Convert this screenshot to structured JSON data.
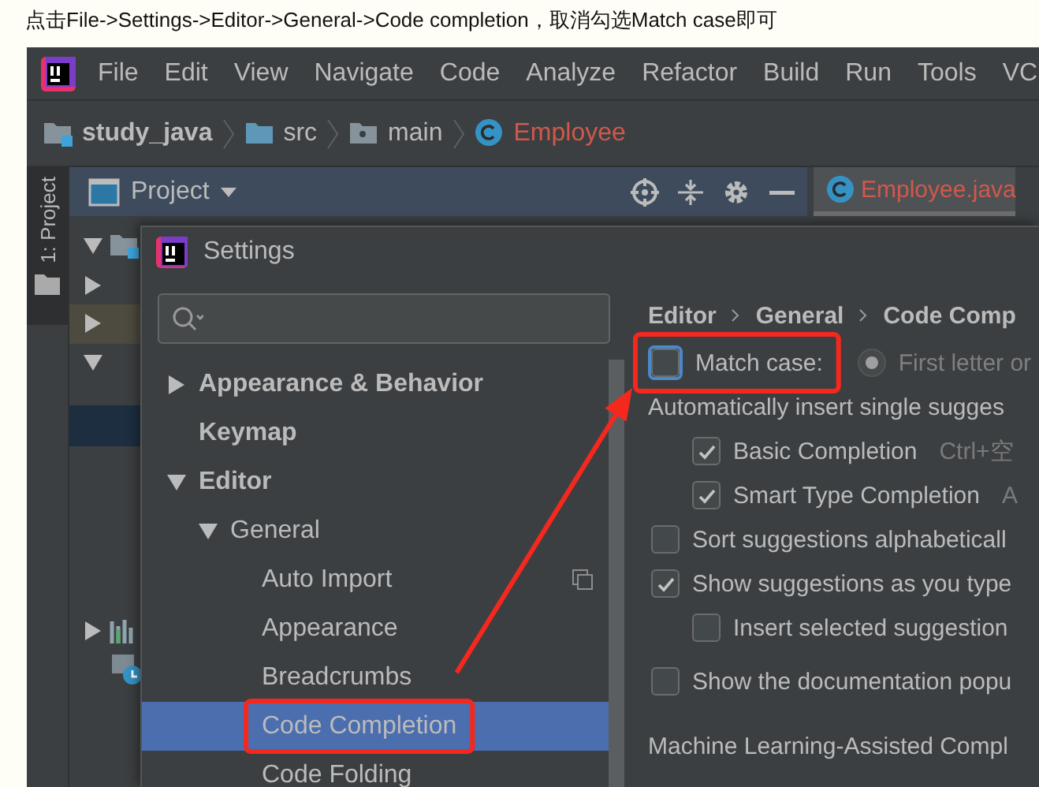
{
  "caption": "点击File->Settings->Editor->General->Code completion，取消勾选Match case即可",
  "menu": [
    "File",
    "Edit",
    "View",
    "Navigate",
    "Code",
    "Analyze",
    "Refactor",
    "Build",
    "Run",
    "Tools",
    "VC"
  ],
  "breadcrumbs": [
    {
      "label": "study_java",
      "kind": "project"
    },
    {
      "label": "src",
      "kind": "folder"
    },
    {
      "label": "main",
      "kind": "package"
    },
    {
      "label": "Employee",
      "kind": "class"
    }
  ],
  "side_tab": "1: Project",
  "project_panel": {
    "title": "Project"
  },
  "editor_tabs": [
    {
      "label": "Employee.java",
      "selected": true
    }
  ],
  "project_tree": [
    {
      "kind": "node",
      "expanded": true,
      "selected": false
    },
    {
      "kind": "node",
      "expanded": false,
      "selected": false
    },
    {
      "kind": "node",
      "expanded": false,
      "selected": true
    },
    {
      "kind": "node",
      "expanded": true,
      "selected": false
    },
    {
      "kind": "blank",
      "selected": true
    },
    {
      "kind": "gap"
    },
    {
      "kind": "chart",
      "expanded": false
    },
    {
      "kind": "console"
    }
  ],
  "settings": {
    "title": "Settings",
    "tree": [
      {
        "label": "Appearance & Behavior",
        "expanded": false,
        "selected": false
      },
      {
        "label": "Keymap",
        "selected": false
      },
      {
        "label": "Editor",
        "expanded": true,
        "selected": false,
        "children": [
          {
            "label": "General",
            "expanded": true,
            "selected": false,
            "children": [
              {
                "label": "Auto Import",
                "selected": false,
                "project_level": true
              },
              {
                "label": "Appearance",
                "selected": false
              },
              {
                "label": "Breadcrumbs",
                "selected": false
              },
              {
                "label": "Code Completion",
                "selected": true,
                "highlighted": true
              },
              {
                "label": "Code Folding",
                "selected": false
              }
            ]
          }
        ]
      }
    ],
    "path": [
      "Editor",
      "General",
      "Code Comp"
    ],
    "options": [
      {
        "kind": "checkbox",
        "label": "Match case:",
        "checked": false,
        "focused": true,
        "highlighted": true,
        "radio": {
          "label": "First letter or",
          "selected": true
        }
      },
      {
        "kind": "heading",
        "label": "Automatically insert single sugges",
        "children": [
          {
            "kind": "checkbox",
            "label": "Basic Completion",
            "checked": true,
            "hint": "Ctrl+空"
          },
          {
            "kind": "checkbox",
            "label": "Smart Type Completion",
            "checked": true,
            "hint": "A"
          }
        ]
      },
      {
        "kind": "checkbox",
        "label": "Sort suggestions alphabeticall",
        "checked": false
      },
      {
        "kind": "checkbox",
        "label": "Show suggestions as you type",
        "checked": true,
        "children": [
          {
            "kind": "checkbox",
            "label": "Insert selected suggestion",
            "checked": false
          }
        ]
      },
      {
        "kind": "spacer"
      },
      {
        "kind": "checkbox",
        "label": "Show the documentation popu",
        "checked": false
      },
      {
        "kind": "spacer"
      },
      {
        "kind": "section",
        "label": "Machine Learning-Assisted Compl"
      }
    ]
  }
}
